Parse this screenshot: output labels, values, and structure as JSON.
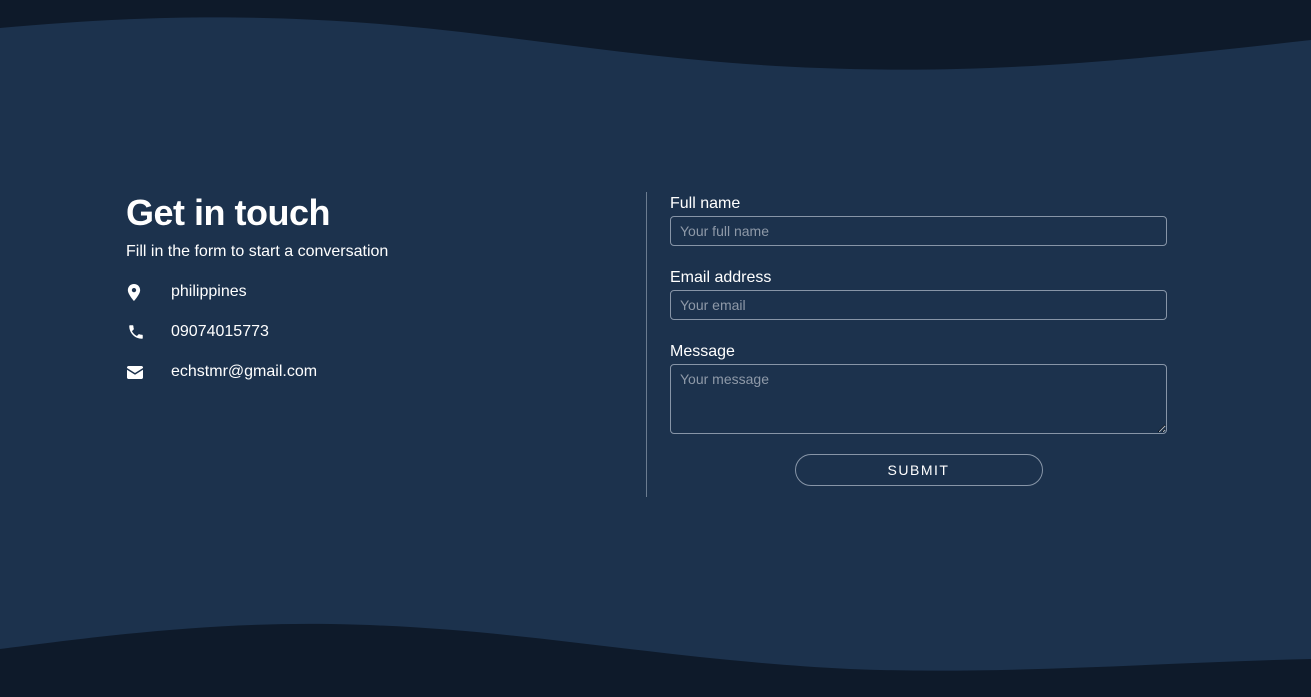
{
  "colors": {
    "background": "#1c324d",
    "wave": "#0e1a2a",
    "text": "#ffffff",
    "border": "#8795a7",
    "placeholder": "#8e99a8"
  },
  "contact": {
    "title": "Get in touch",
    "subtitle": "Fill in the form to start a conversation",
    "items": [
      {
        "icon": "location-pin-icon",
        "text": "philippines"
      },
      {
        "icon": "phone-icon",
        "text": "09074015773"
      },
      {
        "icon": "mail-icon",
        "text": "echstmr@gmail.com"
      }
    ]
  },
  "form": {
    "fullname": {
      "label": "Full name",
      "placeholder": "Your full name",
      "value": ""
    },
    "email": {
      "label": "Email address",
      "placeholder": "Your email",
      "value": ""
    },
    "message": {
      "label": "Message",
      "placeholder": "Your message",
      "value": ""
    },
    "submit_label": "SUBMIT"
  }
}
